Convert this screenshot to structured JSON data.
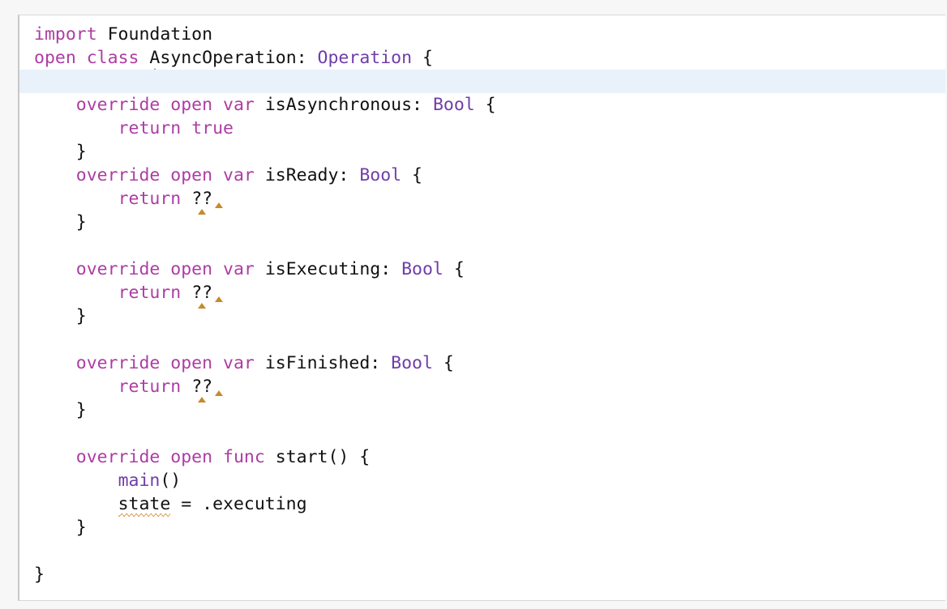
{
  "editor": {
    "lines": [
      {
        "tokens": [
          [
            "kw",
            "import"
          ],
          [
            "plain",
            " Foundation"
          ]
        ]
      },
      {
        "tokens": [
          [
            "kw",
            "open"
          ],
          [
            "plain",
            " "
          ],
          [
            "kw",
            "class"
          ],
          [
            "plain",
            " "
          ],
          [
            "plain-marker",
            "A"
          ],
          [
            "plain",
            "syncOperation: "
          ],
          [
            "ty",
            "Operation"
          ],
          [
            "plain",
            " {"
          ]
        ]
      },
      {
        "current": true,
        "tokens": []
      },
      {
        "tokens": [
          [
            "plain",
            "    "
          ],
          [
            "kw",
            "override"
          ],
          [
            "plain",
            " "
          ],
          [
            "kw",
            "open"
          ],
          [
            "plain",
            " "
          ],
          [
            "kw",
            "var"
          ],
          [
            "plain",
            " isAsynchronous: "
          ],
          [
            "ty",
            "Bool"
          ],
          [
            "plain",
            " {"
          ]
        ]
      },
      {
        "tokens": [
          [
            "plain",
            "        "
          ],
          [
            "kw",
            "return"
          ],
          [
            "plain",
            " "
          ],
          [
            "kw",
            "true"
          ]
        ]
      },
      {
        "tokens": [
          [
            "plain",
            "    }"
          ]
        ]
      },
      {
        "tokens": [
          [
            "plain",
            "    "
          ],
          [
            "kw",
            "override"
          ],
          [
            "plain",
            " "
          ],
          [
            "kw",
            "open"
          ],
          [
            "plain",
            " "
          ],
          [
            "kw",
            "var"
          ],
          [
            "plain",
            " isReady: "
          ],
          [
            "ty",
            "Bool"
          ],
          [
            "plain",
            " {"
          ]
        ]
      },
      {
        "tokens": [
          [
            "plain",
            "        "
          ],
          [
            "kw",
            "return"
          ],
          [
            "plain",
            " "
          ],
          [
            "plain-marker",
            "??"
          ],
          [
            "gap",
            ""
          ]
        ]
      },
      {
        "tokens": [
          [
            "plain",
            "    }"
          ]
        ]
      },
      {
        "tokens": []
      },
      {
        "tokens": [
          [
            "plain",
            "    "
          ],
          [
            "kw",
            "override"
          ],
          [
            "plain",
            " "
          ],
          [
            "kw",
            "open"
          ],
          [
            "plain",
            " "
          ],
          [
            "kw",
            "var"
          ],
          [
            "plain",
            " isExecuting: "
          ],
          [
            "ty",
            "Bool"
          ],
          [
            "plain",
            " {"
          ]
        ]
      },
      {
        "tokens": [
          [
            "plain",
            "        "
          ],
          [
            "kw",
            "return"
          ],
          [
            "plain",
            " "
          ],
          [
            "plain-marker",
            "??"
          ],
          [
            "gap",
            ""
          ]
        ]
      },
      {
        "tokens": [
          [
            "plain",
            "    }"
          ]
        ]
      },
      {
        "tokens": []
      },
      {
        "tokens": [
          [
            "plain",
            "    "
          ],
          [
            "kw",
            "override"
          ],
          [
            "plain",
            " "
          ],
          [
            "kw",
            "open"
          ],
          [
            "plain",
            " "
          ],
          [
            "kw",
            "var"
          ],
          [
            "plain",
            " isFinished: "
          ],
          [
            "ty",
            "Bool"
          ],
          [
            "plain",
            " {"
          ]
        ]
      },
      {
        "tokens": [
          [
            "plain",
            "        "
          ],
          [
            "kw",
            "return"
          ],
          [
            "plain",
            " "
          ],
          [
            "plain-marker",
            "??"
          ],
          [
            "gap",
            ""
          ]
        ]
      },
      {
        "tokens": [
          [
            "plain",
            "    }"
          ]
        ]
      },
      {
        "tokens": []
      },
      {
        "tokens": [
          [
            "plain",
            "    "
          ],
          [
            "kw",
            "override"
          ],
          [
            "plain",
            " "
          ],
          [
            "kw",
            "open"
          ],
          [
            "plain",
            " "
          ],
          [
            "kw",
            "func"
          ],
          [
            "plain",
            " start() {"
          ]
        ]
      },
      {
        "tokens": [
          [
            "plain",
            "        "
          ],
          [
            "ty",
            "main"
          ],
          [
            "plain",
            "()"
          ]
        ]
      },
      {
        "tokens": [
          [
            "plain",
            "        "
          ],
          [
            "squiggle",
            "state"
          ],
          [
            "plain",
            " = .executing"
          ]
        ]
      },
      {
        "tokens": [
          [
            "plain",
            "    }"
          ]
        ]
      },
      {
        "tokens": []
      },
      {
        "tokens": [
          [
            "plain",
            "}"
          ]
        ]
      }
    ]
  },
  "colors": {
    "keyword": "#ad3da4",
    "type": "#703daa",
    "plain": "#111111",
    "current_line": "#e9f2fb",
    "warning_marker": "#c78a2a"
  }
}
